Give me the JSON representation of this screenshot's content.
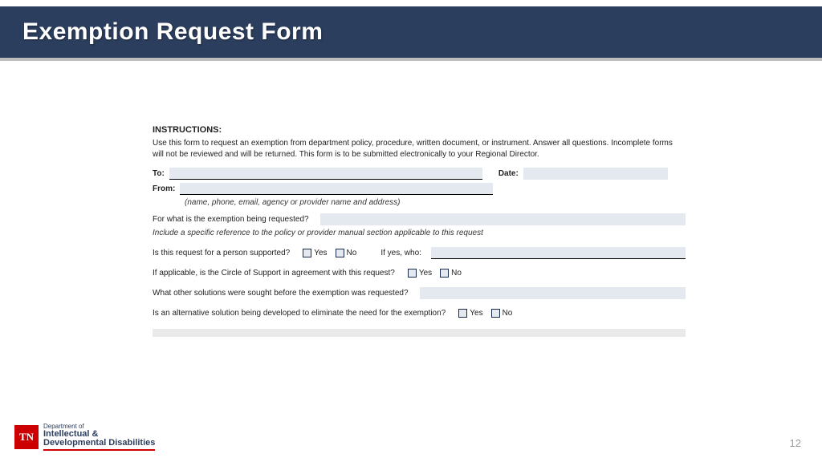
{
  "header": {
    "title": "Exemption Request Form"
  },
  "form": {
    "instructions_label": "INSTRUCTIONS:",
    "instructions_body": "Use this form to request an exemption from department policy, procedure, written document, or instrument. Answer all questions. Incomplete forms will not be reviewed and will be returned. This form is to be submitted electronically to your Regional Director.",
    "to_label": "To:",
    "date_label": "Date:",
    "from_label": "From:",
    "from_hint": "(name, phone, email, agency or provider name and address)",
    "q1_label": "For what is the exemption being requested?",
    "q1_hint": "Include a specific reference to the policy or provider manual section applicable to this request",
    "q2_label": "Is this request for a person supported?",
    "yes": "Yes",
    "no": "No",
    "q2_ifyes": "If yes, who:",
    "q3_label": "If applicable, is the Circle of Support in agreement with this request?",
    "q4_label": "What other solutions were sought before the exemption was requested?",
    "q5_label": "Is an alternative solution being developed to eliminate the need for the exemption?"
  },
  "footer": {
    "tn": "TN",
    "dept_of": "Department of",
    "dept_line1": "Intellectual &",
    "dept_line2": "Developmental Disabilities",
    "page": "12"
  }
}
